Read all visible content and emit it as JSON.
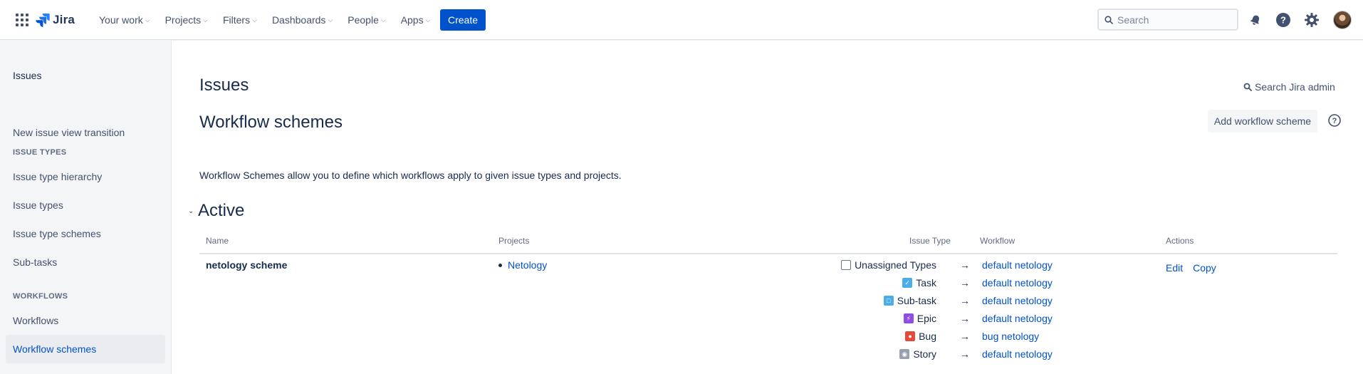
{
  "topnav": {
    "logo_text": "Jira",
    "links": [
      {
        "label": "Your work"
      },
      {
        "label": "Projects"
      },
      {
        "label": "Filters"
      },
      {
        "label": "Dashboards"
      },
      {
        "label": "People"
      },
      {
        "label": "Apps"
      }
    ],
    "create_label": "Create",
    "search_placeholder": "Search",
    "icons": [
      "app-switcher-icon",
      "notifications-icon",
      "help-icon",
      "settings-icon",
      "avatar"
    ]
  },
  "sidebar": {
    "title": "Issues",
    "items": [
      {
        "label": "New issue view transition"
      },
      {
        "label": "Issue type hierarchy"
      },
      {
        "label": "Issue types"
      },
      {
        "label": "Issue type schemes"
      },
      {
        "label": "Sub-tasks"
      },
      {
        "label": "Workflows"
      },
      {
        "label": "Workflow schemes",
        "selected": true
      }
    ],
    "sections": {
      "issue_types": "ISSUE TYPES",
      "workflows": "WORKFLOWS"
    }
  },
  "main": {
    "page_title": "Issues",
    "admin_search": "Search Jira admin",
    "section_title": "Workflow schemes",
    "add_button": "Add workflow scheme",
    "intro": "Workflow Schemes allow you to define which workflows apply to given issue types and projects.",
    "active_title": "Active",
    "table": {
      "headers": {
        "name": "Name",
        "projects": "Projects",
        "issue_type": "Issue Type",
        "workflow": "Workflow",
        "actions": "Actions"
      },
      "scheme": {
        "name": "netology scheme",
        "project": "Netology",
        "mappings": [
          {
            "issue_type": "Unassigned Types",
            "icon": "unassigned-icon",
            "arrow": "→",
            "workflow": "default netology"
          },
          {
            "issue_type": "Task",
            "icon": "task-icon",
            "arrow": "→",
            "workflow": "default netology"
          },
          {
            "issue_type": "Sub-task",
            "icon": "subtask-icon",
            "arrow": "→",
            "workflow": "default netology"
          },
          {
            "issue_type": "Epic",
            "icon": "epic-icon",
            "arrow": "→",
            "workflow": "default netology"
          },
          {
            "issue_type": "Bug",
            "icon": "bug-icon",
            "arrow": "→",
            "workflow": "bug netology"
          },
          {
            "issue_type": "Story",
            "icon": "story-icon",
            "arrow": "→",
            "workflow": "default netology"
          }
        ],
        "actions": {
          "edit": "Edit",
          "copy": "Copy"
        }
      }
    }
  },
  "colors": {
    "brand_blue": "#0052cc",
    "task": "#4bade8",
    "subtask": "#4bade8",
    "epic": "#904ee2",
    "bug": "#e5493a",
    "story": "#97a0af"
  }
}
